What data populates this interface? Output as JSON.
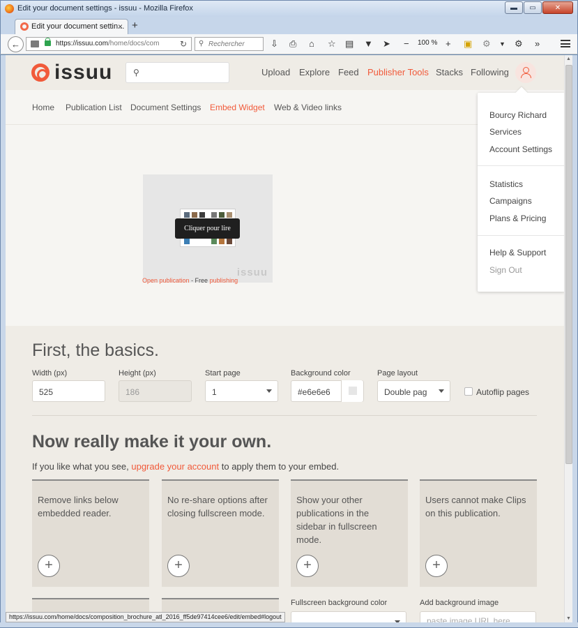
{
  "window": {
    "title": "Edit your document settings - issuu - Mozilla Firefox",
    "min": "▬",
    "max": "▭",
    "close": "✕"
  },
  "tab": {
    "label": "Edit your document settin...",
    "close": "×",
    "new": "+"
  },
  "toolbar": {
    "url_host": "https://issuu.com",
    "url_path": "/home/docs/com",
    "search_placeholder": "Rechercher",
    "zoom": "100 %"
  },
  "site": {
    "logo": "issuu",
    "nav": [
      "Upload",
      "Explore",
      "Feed",
      "Publisher Tools",
      "Stacks",
      "Following"
    ],
    "active_nav": "Publisher Tools",
    "subnav": [
      "Home",
      "Publication List",
      "Document Settings",
      "Embed Widget",
      "Web & Video links"
    ],
    "active_subnav": "Embed Widget"
  },
  "embed": {
    "cta": "Cliquer pour lire",
    "watermark": "issuu",
    "open_publication": "Open publication",
    "sep": " - Free ",
    "publishing": "publishing"
  },
  "user_menu": {
    "group1": [
      "Bourcy Richard",
      "Services",
      "Account Settings"
    ],
    "group2": [
      "Statistics",
      "Campaigns",
      "Plans & Pricing"
    ],
    "group3": [
      "Help & Support",
      "Sign Out"
    ]
  },
  "basics": {
    "heading": "First, the basics.",
    "width_label": "Width (px)",
    "width_value": "525",
    "height_label": "Height (px)",
    "height_value": "186",
    "start_label": "Start page",
    "start_value": "1",
    "bg_label": "Background color",
    "bg_value": "#e6e6e6",
    "layout_label": "Page layout",
    "layout_value": "Double pag",
    "autoflip_label": "Autoflip pages"
  },
  "own": {
    "heading": "Now really make it your own.",
    "lead_before": "If you like what you see, ",
    "lead_link": "upgrade your account",
    "lead_after": " to apply them to your embed.",
    "cards": [
      "Remove links below embedded reader.",
      "No re-share options after closing fullscreen mode.",
      "Show your other publications in the sidebar in fullscreen mode.",
      "Users cannot make Clips on this publication."
    ],
    "plus": "+",
    "fs_bg_label": "Fullscreen background color",
    "add_bg_label": "Add background image",
    "add_bg_placeholder": "paste image URL here"
  },
  "status_url": "https://issuu.com/home/docs/composition_brochure_atl_2016_ff5de97414cee6/edit/embed#logout",
  "colors": {
    "accent": "#f15a3a",
    "bg": "#efece6"
  }
}
